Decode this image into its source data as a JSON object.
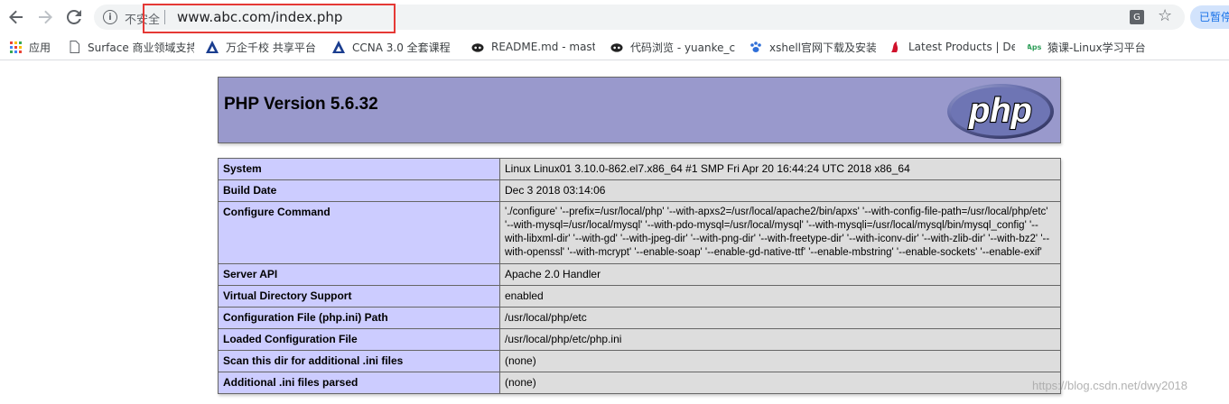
{
  "browser": {
    "security_label": "不安全",
    "url": "www.abc.com/index.php",
    "paused_label": "已暂停",
    "bookmarks": [
      {
        "label": "应用",
        "icon": "apps-grid-icon"
      },
      {
        "label": "Surface 商业领域支持",
        "icon": "page-icon"
      },
      {
        "label": "万企千校 共享平台",
        "icon": "triangle-logo-icon"
      },
      {
        "label": "CCNA 3.0 全套课程",
        "icon": "triangle-logo-icon"
      },
      {
        "label": "README.md - master",
        "icon": "github-icon"
      },
      {
        "label": "代码浏览 - yuanke_c",
        "icon": "github-icon"
      },
      {
        "label": "xshell官网下载及安装",
        "icon": "paw-icon"
      },
      {
        "label": "Latest Products | De",
        "icon": "red-logo-icon"
      },
      {
        "label": "猿课-Linux学习平台",
        "icon": "apes-logo-icon"
      }
    ]
  },
  "phpinfo": {
    "title": "PHP Version 5.6.32",
    "logo_text": "php",
    "rows": [
      {
        "key": "System",
        "value": "Linux Linux01 3.10.0-862.el7.x86_64 #1 SMP Fri Apr 20 16:44:24 UTC 2018 x86_64"
      },
      {
        "key": "Build Date",
        "value": "Dec 3 2018 03:14:06"
      },
      {
        "key": "Configure Command",
        "value": "'./configure' '--prefix=/usr/local/php' '--with-apxs2=/usr/local/apache2/bin/apxs' '--with-config-file-path=/usr/local/php/etc' '--with-mysql=/usr/local/mysql' '--with-pdo-mysql=/usr/local/mysql' '--with-mysqli=/usr/local/mysql/bin/mysql_config' '--with-libxml-dir' '--with-gd' '--with-jpeg-dir' '--with-png-dir' '--with-freetype-dir' '--with-iconv-dir' '--with-zlib-dir' '--with-bz2' '--with-openssl' '--with-mcrypt' '--enable-soap' '--enable-gd-native-ttf' '--enable-mbstring' '--enable-sockets' '--enable-exif'"
      },
      {
        "key": "Server API",
        "value": "Apache 2.0 Handler"
      },
      {
        "key": "Virtual Directory Support",
        "value": "enabled"
      },
      {
        "key": "Configuration File (php.ini) Path",
        "value": "/usr/local/php/etc"
      },
      {
        "key": "Loaded Configuration File",
        "value": "/usr/local/php/etc/php.ini"
      },
      {
        "key": "Scan this dir for additional .ini files",
        "value": "(none)"
      },
      {
        "key": "Additional .ini files parsed",
        "value": "(none)"
      }
    ]
  },
  "watermark": "https://blog.csdn.net/dwy2018"
}
